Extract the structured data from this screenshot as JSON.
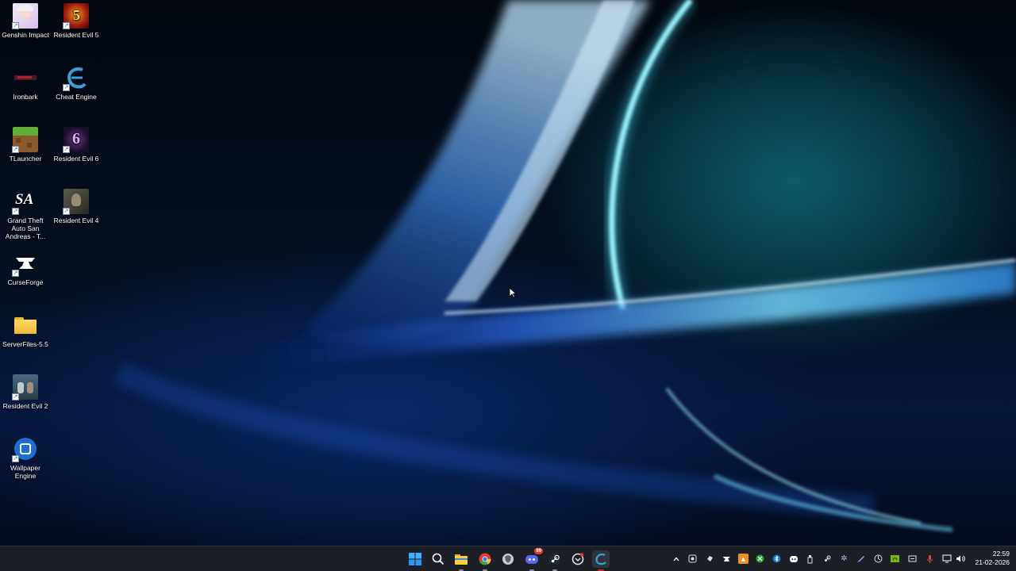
{
  "desktop": {
    "icons": [
      {
        "label": "Genshin Impact"
      },
      {
        "label": "Resident Evil 5"
      },
      {
        "label": "Ironbark"
      },
      {
        "label": "Cheat Engine"
      },
      {
        "label": "TLauncher"
      },
      {
        "label": "Resident Evil 6"
      },
      {
        "label": "Grand Theft Auto San Andreas - T..."
      },
      {
        "label": "Resident Evil 4"
      },
      {
        "label": "CurseForge"
      },
      {
        "label": "ServerFiles-5.5"
      },
      {
        "label": "Resident Evil 2"
      },
      {
        "label": "Wallpaper Engine"
      }
    ]
  },
  "taskbar": {
    "apps": [
      {
        "icon": "windows-start-icon"
      },
      {
        "icon": "search-icon"
      },
      {
        "icon": "file-explorer-icon"
      },
      {
        "icon": "chrome-icon"
      },
      {
        "icon": "app-shield-icon"
      },
      {
        "icon": "discord-icon",
        "badge": "99"
      },
      {
        "icon": "steam-icon"
      },
      {
        "icon": "overwolf-icon"
      },
      {
        "icon": "cheat-engine-icon"
      }
    ],
    "tray": {
      "icons": [
        "chevron-up-icon",
        "tray-app-icon",
        "tray-app-icon",
        "curseforge-icon",
        "tray-app-icon",
        "xbox-icon",
        "bluetooth-icon",
        "discord-icon",
        "usb-icon",
        "steam-icon",
        "settings-icon",
        "pen-icon",
        "tray-app-icon",
        "nvidia-icon",
        "tray-app-icon",
        "microphone-icon",
        "network-icon",
        "volume-icon"
      ]
    },
    "clock": {
      "time": "22:59",
      "date": "21-02-2026"
    }
  }
}
